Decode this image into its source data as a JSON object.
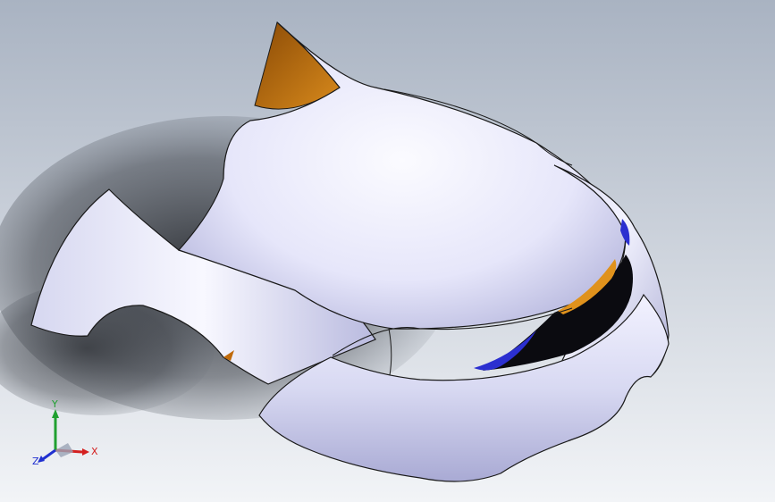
{
  "viewport": {
    "background_top": "#a9b3c2",
    "background_bottom": "#f2f4f7",
    "shadow_color": "#2b2e33"
  },
  "model": {
    "body_light": "#f7f7ff",
    "body_mid": "#cfd0ee",
    "body_dark": "#8c8fc0",
    "edge_color": "#1a1a1a",
    "accent_orange": "#c06b0c",
    "accent_blue": "#2b2fd0"
  },
  "triad": {
    "x_label": "X",
    "y_label": "Y",
    "z_label": "Z",
    "x_color": "#d42020",
    "y_color": "#20a030",
    "z_color": "#2030d0"
  }
}
